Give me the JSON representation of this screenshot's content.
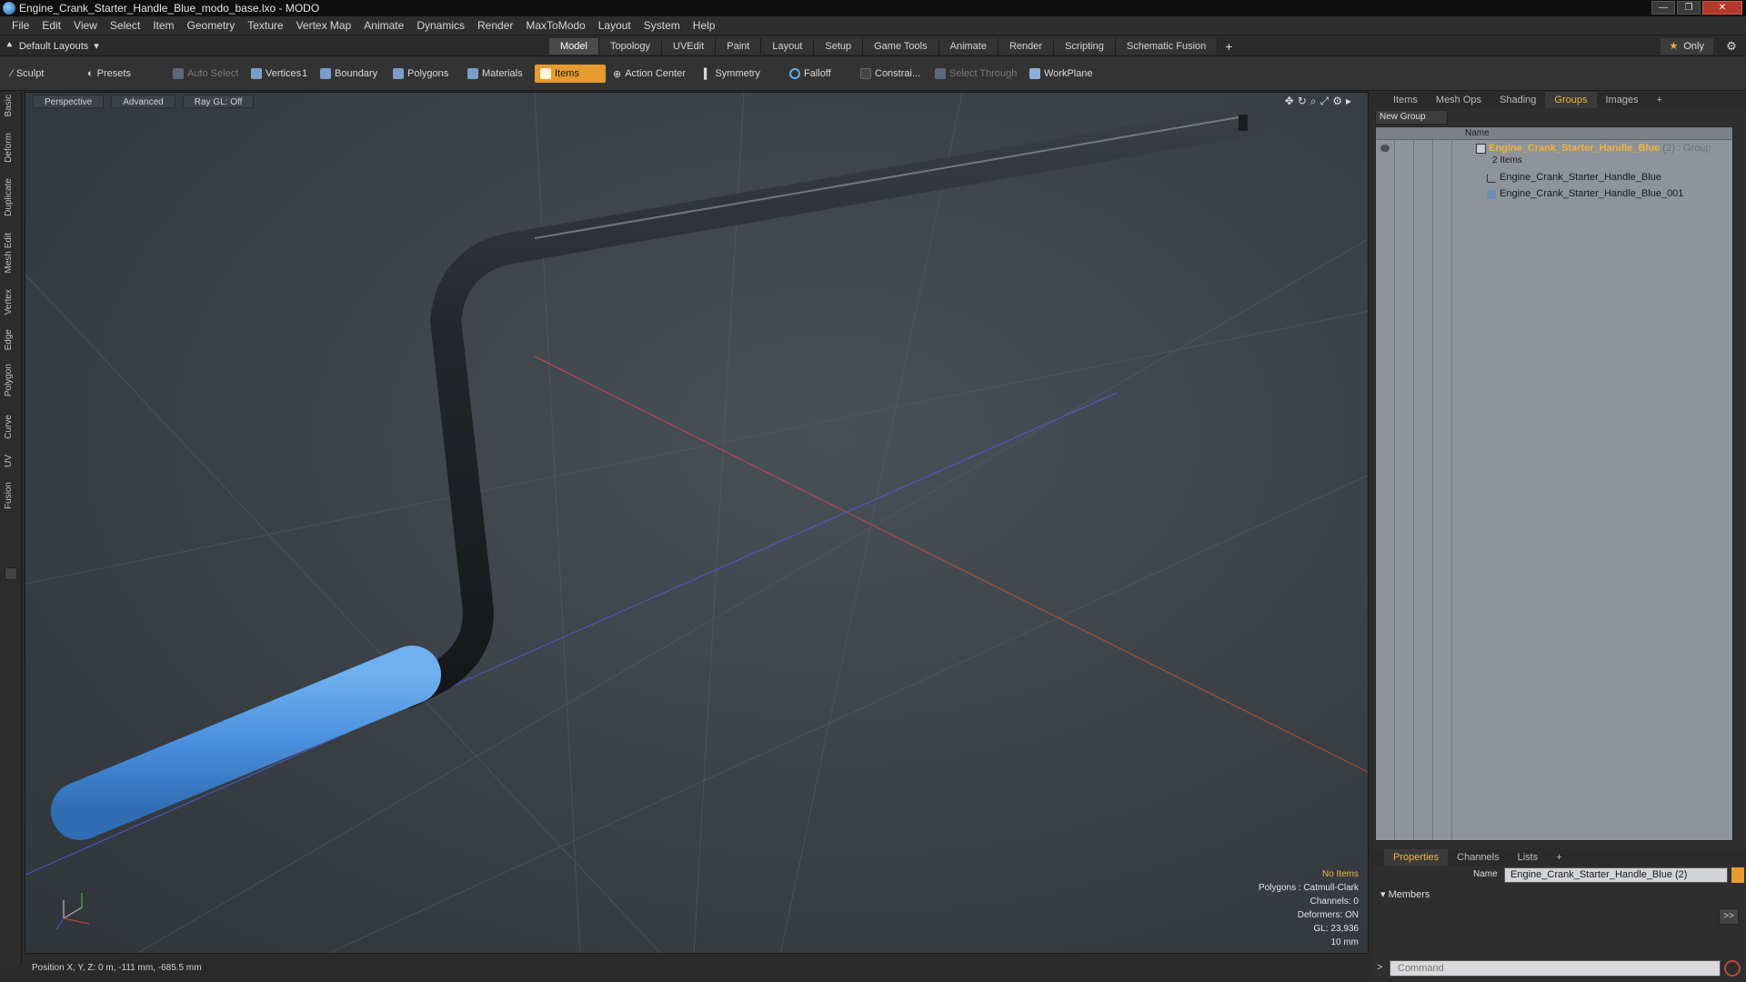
{
  "window": {
    "title": "Engine_Crank_Starter_Handle_Blue_modo_base.lxo - MODO"
  },
  "menu": [
    "File",
    "Edit",
    "View",
    "Select",
    "Item",
    "Geometry",
    "Texture",
    "Vertex Map",
    "Animate",
    "Dynamics",
    "Render",
    "MaxToModo",
    "Layout",
    "System",
    "Help"
  ],
  "layout": {
    "selector": "Default Layouts",
    "tabs": [
      "Model",
      "Topology",
      "UVEdit",
      "Paint",
      "Layout",
      "Setup",
      "Game Tools",
      "Animate",
      "Render",
      "Scripting",
      "Schematic Fusion"
    ],
    "active_tab": "Model",
    "only_label": "Only"
  },
  "toolbar": {
    "sculpt": "Sculpt",
    "presets": "Presets",
    "auto_select": "Auto Select",
    "vertices": "Vertices",
    "vertices_count": "1",
    "boundary": "Boundary",
    "polygons": "Polygons",
    "materials": "Materials",
    "items": "Items",
    "action_center": "Action Center",
    "symmetry": "Symmetry",
    "falloff": "Falloff",
    "constrain": "Constrai...",
    "select_through": "Select Through",
    "workplane": "WorkPlane"
  },
  "left_tabs": [
    "Basic",
    "Deform",
    "Duplicate",
    "Mesh Edit",
    "Vertex",
    "Edge",
    "Polygon",
    "Curve",
    "UV",
    "Fusion"
  ],
  "viewport": {
    "view": "Perspective",
    "shading": "Advanced",
    "raygl": "Ray GL: Off",
    "info": {
      "no_items": "No Items",
      "polygons": "Polygons : Catmull-Clark",
      "channels": "Channels: 0",
      "deformers": "Deformers: ON",
      "gl": "GL: 23,936",
      "scale": "10 mm"
    },
    "colors": {
      "handle_grip": "#4a8fdc",
      "crank_rod": "#262a2e",
      "axis_x": "#d04a3a",
      "axis_z": "#4a5ad0"
    }
  },
  "status": {
    "position": "Position X, Y, Z:  0 m, -111 mm, -685.5 mm"
  },
  "right_panel": {
    "tabs": [
      "Items",
      "Mesh Ops",
      "Shading",
      "Groups",
      "Images"
    ],
    "active_tab": "Groups",
    "new_group": "New Group",
    "name_header": "Name",
    "group_name": "Engine_Crank_Starter_Handle_Blue",
    "group_suffix": "(2) : Group",
    "group_count": "2 Items",
    "items": [
      "Engine_Crank_Starter_Handle_Blue",
      "Engine_Crank_Starter_Handle_Blue_001"
    ],
    "bottom_tabs": [
      "Properties",
      "Channels",
      "Lists"
    ],
    "bottom_active": "Properties",
    "name_label": "Name",
    "name_value": "Engine_Crank_Starter_Handle_Blue (2)",
    "members": "Members",
    "members_btn": ">>",
    "command_placeholder": "Command"
  }
}
